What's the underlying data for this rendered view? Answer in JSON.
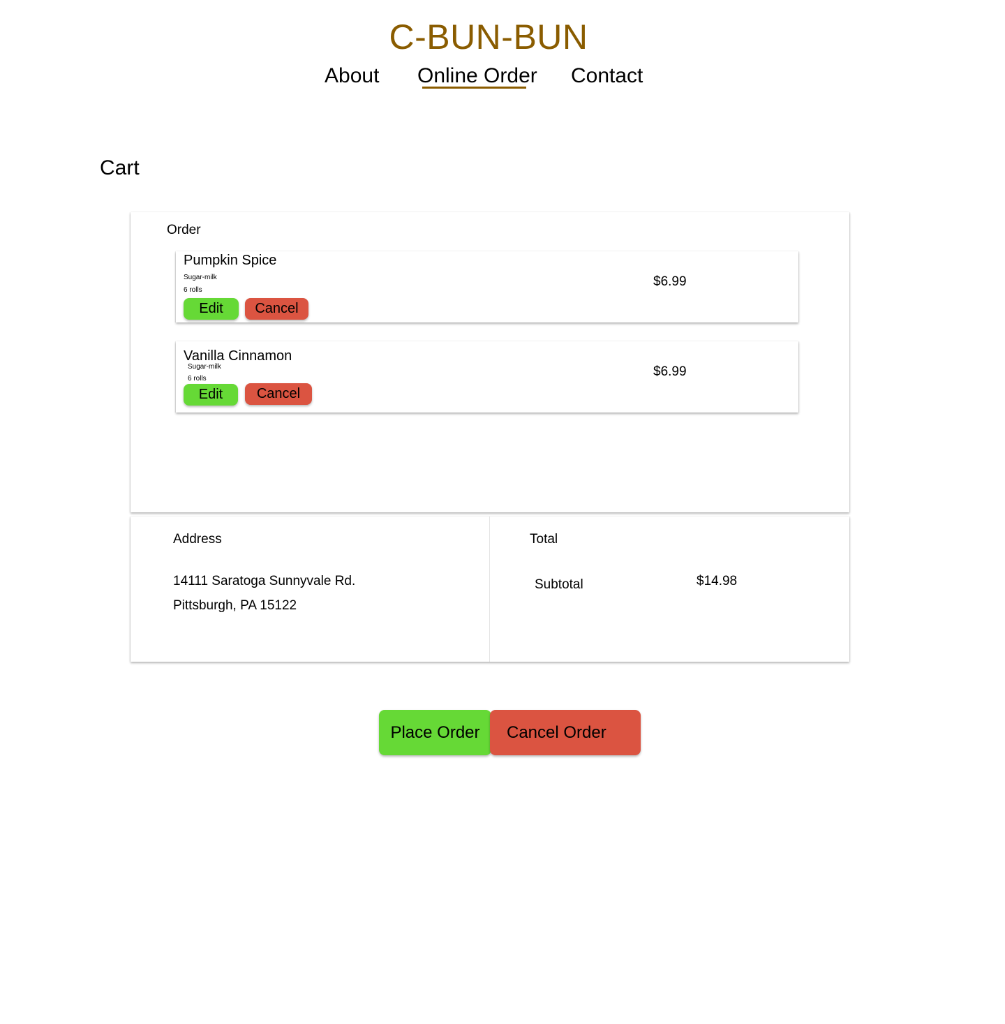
{
  "header": {
    "brand": "C-BUN-BUN",
    "nav": {
      "about": "About",
      "online_order": "Online Order",
      "contact": "Contact"
    }
  },
  "cart": {
    "title": "Cart",
    "order_label": "Order",
    "items": [
      {
        "name": "Pumpkin Spice",
        "glaze": "Sugar-milk",
        "quantity": "6 rolls",
        "price": "$6.99",
        "edit_label": "Edit",
        "cancel_label": "Cancel"
      },
      {
        "name": "Vanilla Cinnamon",
        "glaze": "Sugar-milk",
        "quantity": "6 rolls",
        "price": "$6.99",
        "edit_label": "Edit",
        "cancel_label": "Cancel"
      }
    ]
  },
  "address": {
    "label": "Address",
    "line1": "14111 Saratoga Sunnyvale Rd.",
    "line2": "Pittsburgh, PA 15122"
  },
  "total": {
    "label": "Total",
    "subtotal_label": "Subtotal",
    "subtotal_value": "$14.98"
  },
  "actions": {
    "place_order": "Place Order",
    "cancel_order": "Cancel Order"
  },
  "colors": {
    "brand": "#8a5c00",
    "confirm": "#66d936",
    "danger": "#db5441"
  }
}
